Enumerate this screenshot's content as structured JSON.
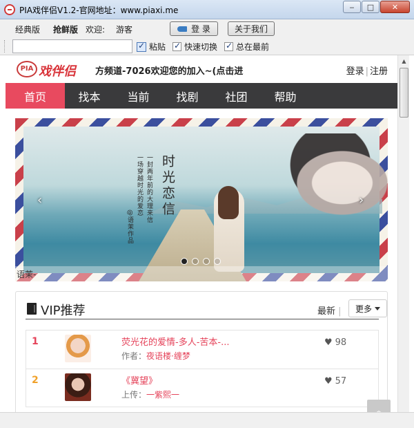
{
  "window": {
    "title": "PIA戏伴侣V1.2-官网地址：www.piaxi.me",
    "minimize_icon": "minimize-icon",
    "maximize_icon": "maximize-icon",
    "close_icon": "close-icon"
  },
  "menu": {
    "classic": "经典版",
    "early": "抢鲜版",
    "welcome": "欢迎:",
    "guest": "游客",
    "login_button": "登 录",
    "about_button": "关于我们"
  },
  "toolbar": {
    "input_value": "",
    "paste": "粘贴",
    "quick_switch": "快速切换",
    "always_top": "总在最前"
  },
  "site": {
    "logo_pia": "PIA",
    "logo_text": "戏伴侣",
    "marquee": "方频道-7026欢迎您的加入~(点击进",
    "login": "登录",
    "register": "注册",
    "auth_separator": "|",
    "nav": [
      "首页",
      "找本",
      "当前",
      "找剧",
      "社团",
      "帮助"
    ]
  },
  "banner": {
    "calligraphy_title": "时光恋信",
    "calligraphy_lines": [
      "一封两年前的大理来信",
      "一场穿越时光的爱恋",
      "@语茉作品"
    ],
    "caption": "语茉-",
    "prev_icon": "chevron-left-icon",
    "next_icon": "chevron-right-icon",
    "slide_count": 4,
    "active_slide": 1
  },
  "vip": {
    "title": "VIP推荐",
    "newest": "最新",
    "more": "更多",
    "items": [
      {
        "rank": "1",
        "rank_color": "#e5435a",
        "title": "荧光花的爱情-多人-苦本-...",
        "meta_label": "作者：",
        "meta_value": "夜语楼·缠梦",
        "likes": "98"
      },
      {
        "rank": "2",
        "rank_color": "#f0a12a",
        "title": "《冀望》",
        "meta_label": "上传：",
        "meta_value": "一紫熙一",
        "likes": "57"
      }
    ]
  },
  "colors": {
    "nav_bg": "#3a3a3c",
    "nav_active": "#e84a5f",
    "accent": "#e5435a"
  }
}
